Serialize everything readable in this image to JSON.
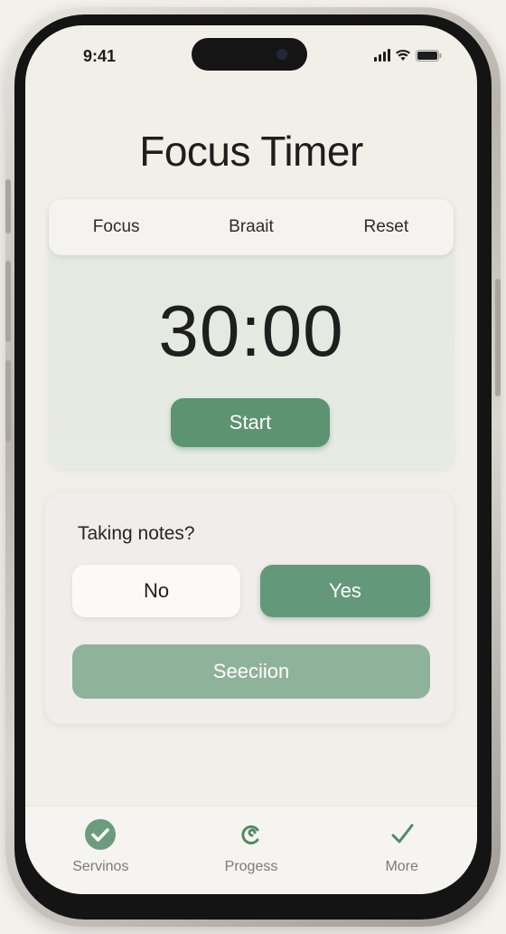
{
  "status_bar": {
    "time": "9:41"
  },
  "header": {
    "title": "Focus Timer"
  },
  "mode_tabs": [
    {
      "label": "Focus"
    },
    {
      "label": "Braait"
    },
    {
      "label": "Reset"
    }
  ],
  "timer": {
    "display": "30:00",
    "start_label": "Start"
  },
  "notes": {
    "question": "Taking notes?",
    "no_label": "No",
    "yes_label": "Yes",
    "session_label": "Seeciion"
  },
  "tab_bar": {
    "items": [
      {
        "label": "Servinos",
        "icon": "check-circle-icon"
      },
      {
        "label": "Progess",
        "icon": "swirl-icon"
      },
      {
        "label": "More",
        "icon": "checkmark-icon"
      }
    ]
  },
  "colors": {
    "accent": "#5c9370",
    "accent_light": "#8fb29a",
    "background": "#f2efe9"
  }
}
